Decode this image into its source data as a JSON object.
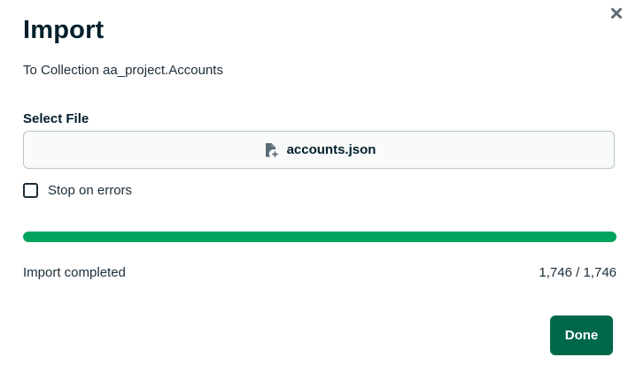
{
  "dialog": {
    "title": "Import",
    "subtitle": "To Collection aa_project.Accounts",
    "close_icon": "close-icon"
  },
  "file_select": {
    "label": "Select File",
    "file_name": "accounts.json",
    "icon": "file-add-icon"
  },
  "options": {
    "stop_on_errors_label": "Stop on errors",
    "stop_on_errors_checked": false
  },
  "progress": {
    "fraction": 1.0,
    "status": "Import completed",
    "count": "1,746 / 1,746",
    "color": "#00a35c"
  },
  "actions": {
    "done_label": "Done",
    "done_color": "#00684a"
  }
}
